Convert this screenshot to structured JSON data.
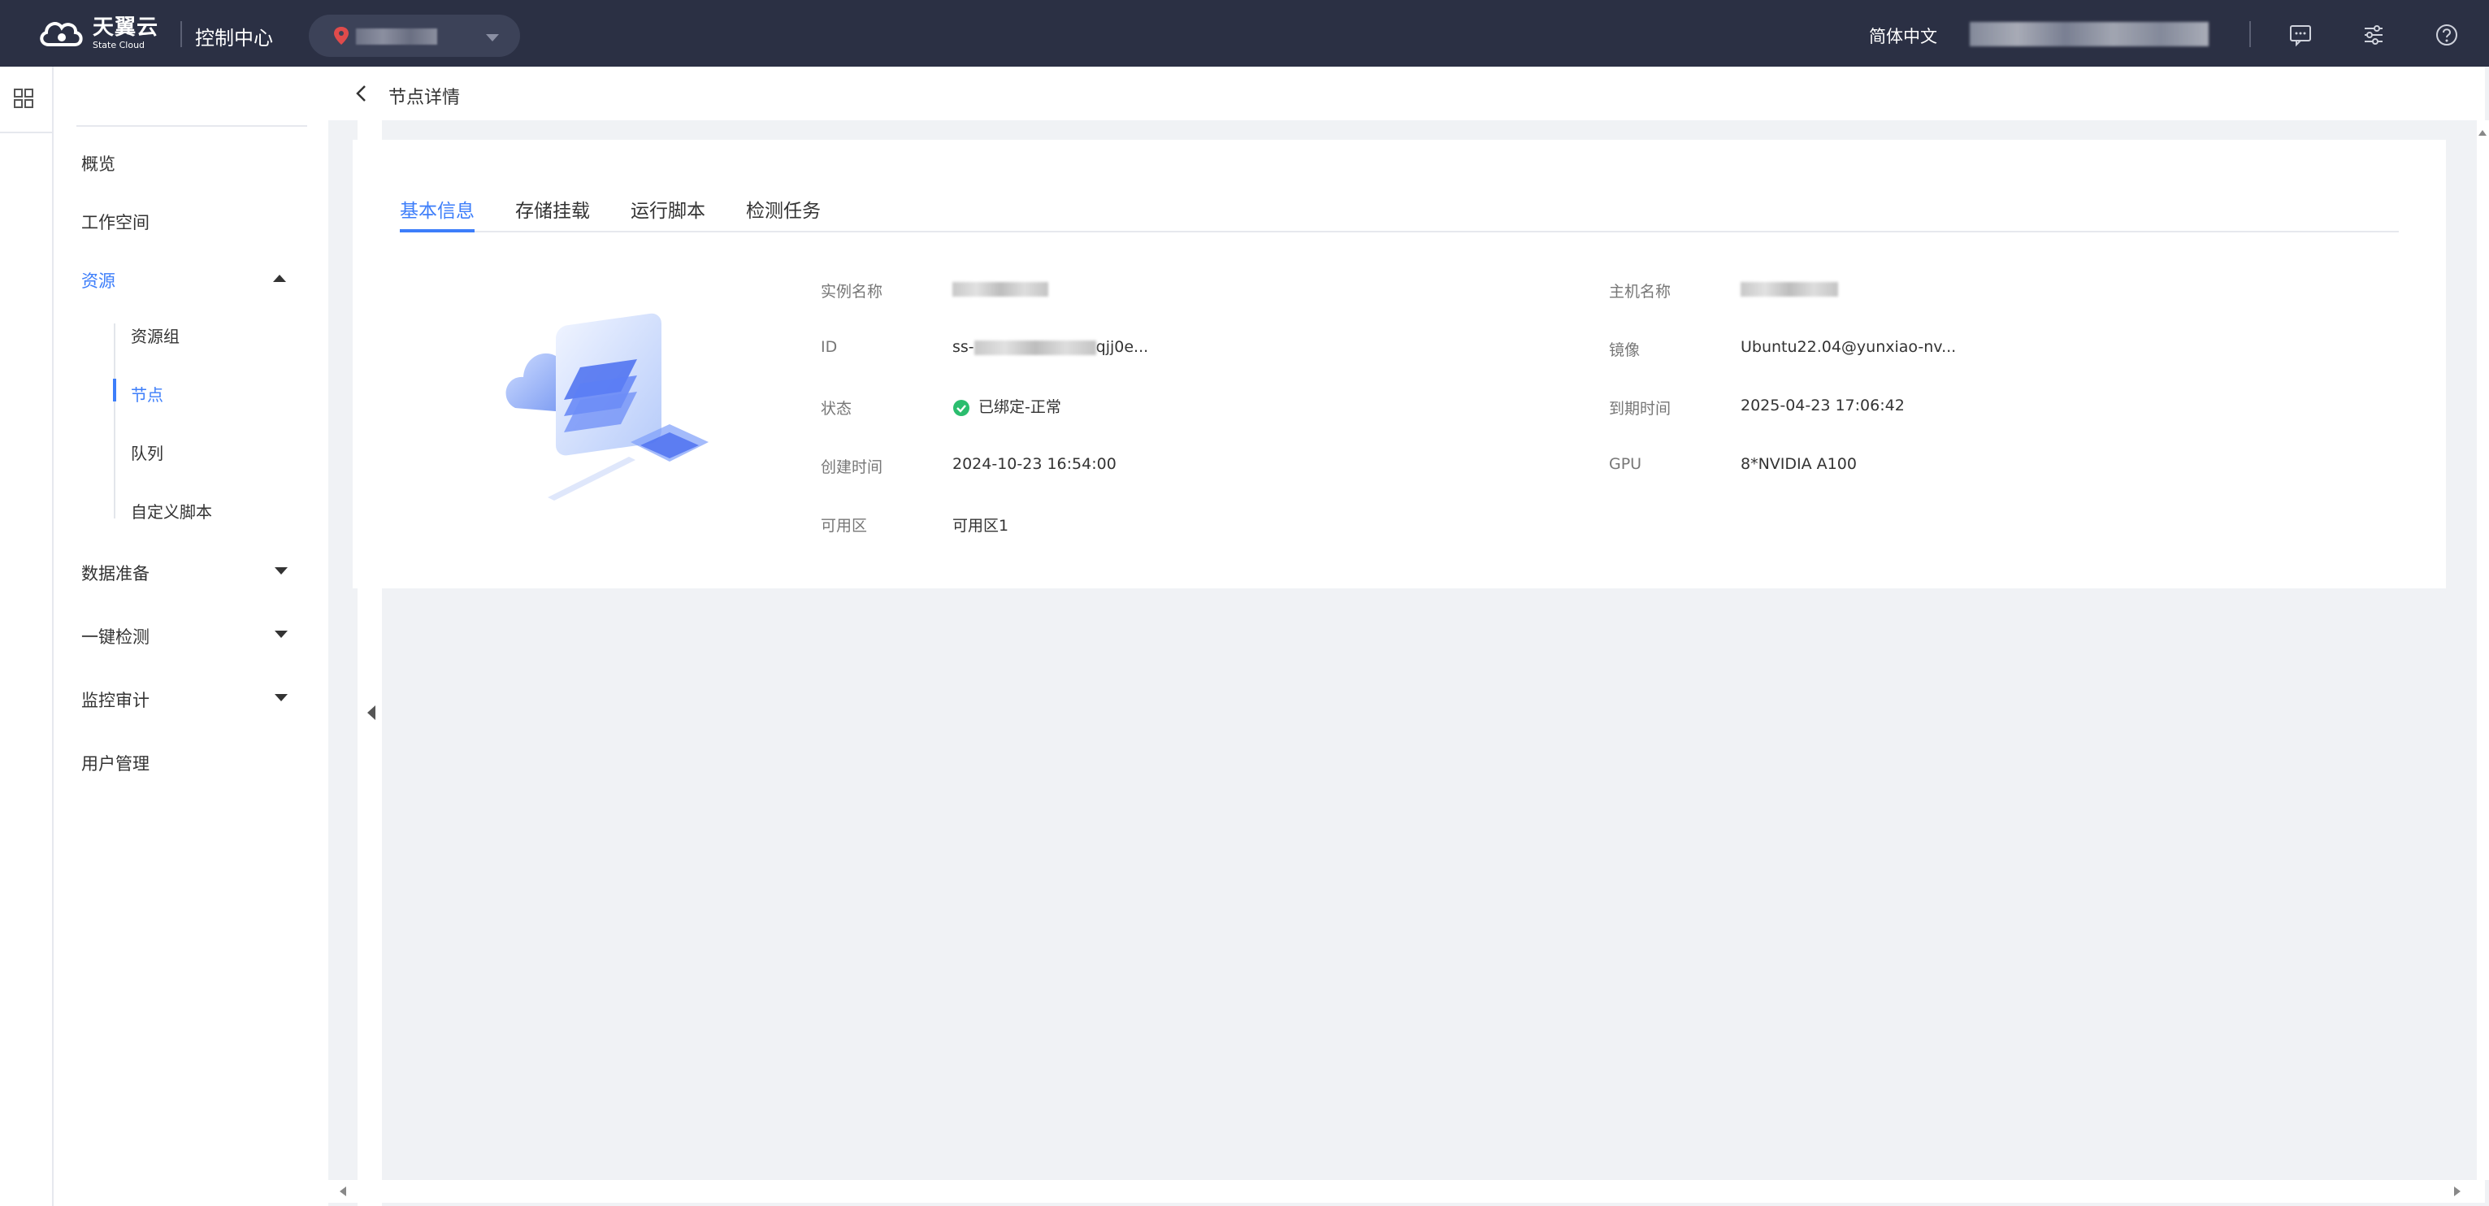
{
  "topbar": {
    "logo_cn": "天翼云",
    "logo_en": "State Cloud",
    "console_title": "控制中心",
    "language": "简体中文",
    "icons": [
      "message-icon",
      "settings-sliders-icon",
      "help-icon"
    ]
  },
  "sidebar": {
    "items": [
      {
        "label": "概览"
      },
      {
        "label": "工作空间"
      },
      {
        "label": "资源",
        "expanded": true,
        "active": true,
        "children": [
          {
            "label": "资源组"
          },
          {
            "label": "节点",
            "active": true
          },
          {
            "label": "队列"
          },
          {
            "label": "自定义脚本"
          }
        ]
      },
      {
        "label": "数据准备"
      },
      {
        "label": "一键检测"
      },
      {
        "label": "监控审计"
      },
      {
        "label": "用户管理"
      }
    ]
  },
  "header": {
    "title": "节点详情"
  },
  "tabs": [
    {
      "label": "基本信息",
      "active": true
    },
    {
      "label": "存储挂载"
    },
    {
      "label": "运行脚本"
    },
    {
      "label": "检测任务"
    }
  ],
  "details": {
    "left": [
      {
        "label": "实例名称",
        "value": ""
      },
      {
        "label": "ID",
        "value_prefix": "ss-",
        "value_suffix": "qjj0e..."
      },
      {
        "label": "状态",
        "value": "已绑定-正常"
      },
      {
        "label": "创建时间",
        "value": "2024-10-23 16:54:00"
      },
      {
        "label": "可用区",
        "value": "可用区1"
      }
    ],
    "right": [
      {
        "label": "主机名称",
        "value": ""
      },
      {
        "label": "镜像",
        "value": "Ubuntu22.04@yunxiao-nv..."
      },
      {
        "label": "到期时间",
        "value": "2025-04-23 17:06:42"
      },
      {
        "label": "GPU",
        "value": "8*NVIDIA A100"
      }
    ]
  },
  "colors": {
    "topbar_bg": "#2b3044",
    "accent": "#3d7efa",
    "status_ok": "#2bbd6e",
    "page_bg": "#f0f2f5"
  }
}
